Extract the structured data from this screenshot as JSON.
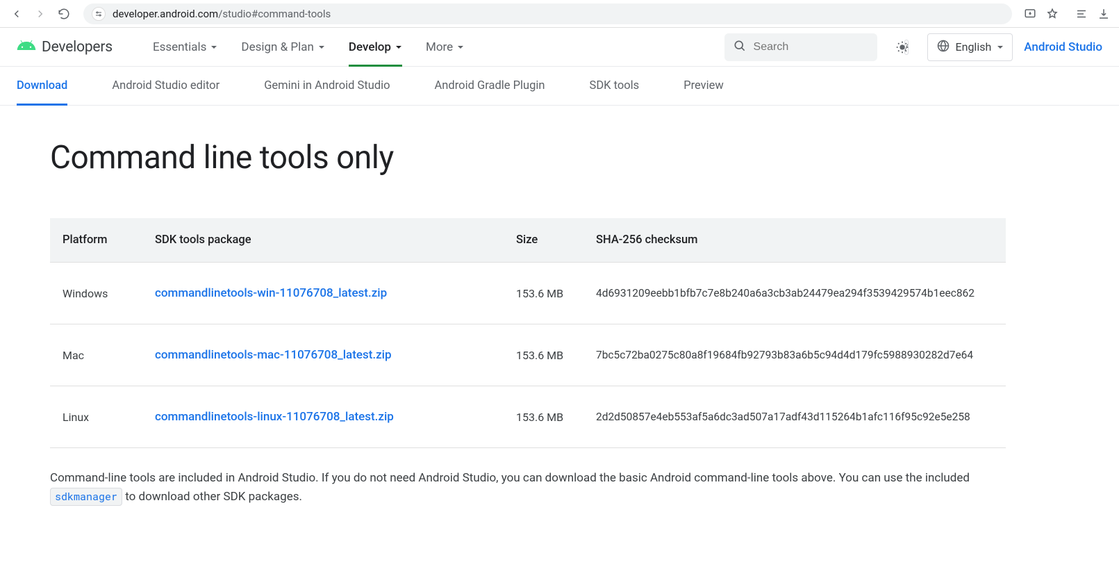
{
  "browser": {
    "url_prefix": "developer.android.com",
    "url_path": "/studio#command-tools"
  },
  "topnav": {
    "brand": "Developers",
    "items": [
      "Essentials",
      "Design & Plan",
      "Develop",
      "More"
    ],
    "active_index": 2,
    "search_placeholder": "Search",
    "search_key": "/",
    "language": "English",
    "studio_link": "Android Studio"
  },
  "subnav": {
    "items": [
      "Download",
      "Android Studio editor",
      "Gemini in Android Studio",
      "Android Gradle Plugin",
      "SDK tools",
      "Preview"
    ],
    "active_index": 0
  },
  "page": {
    "heading": "Command line tools only",
    "table_headers": [
      "Platform",
      "SDK tools package",
      "Size",
      "SHA-256 checksum"
    ],
    "rows": [
      {
        "platform": "Windows",
        "package": "commandlinetools-win-11076708_latest.zip",
        "size": "153.6 MB",
        "sha": "4d6931209eebb1bfb7c7e8b240a6a3cb3ab24479ea294f3539429574b1eec862"
      },
      {
        "platform": "Mac",
        "package": "commandlinetools-mac-11076708_latest.zip",
        "size": "153.6 MB",
        "sha": "7bc5c72ba0275c80a8f19684fb92793b83a6b5c94d4d179fc5988930282d7e64"
      },
      {
        "platform": "Linux",
        "package": "commandlinetools-linux-11076708_latest.zip",
        "size": "153.6 MB",
        "sha": "2d2d50857e4eb553af5a6dc3ad507a17adf43d115264b1afc116f95c92e5e258"
      }
    ],
    "para_pre": "Command-line tools are included in Android Studio. If you do not need Android Studio, you can download the basic Android command-line tools above. You can use the included ",
    "para_code": "sdkmanager",
    "para_post": " to download other SDK packages."
  }
}
